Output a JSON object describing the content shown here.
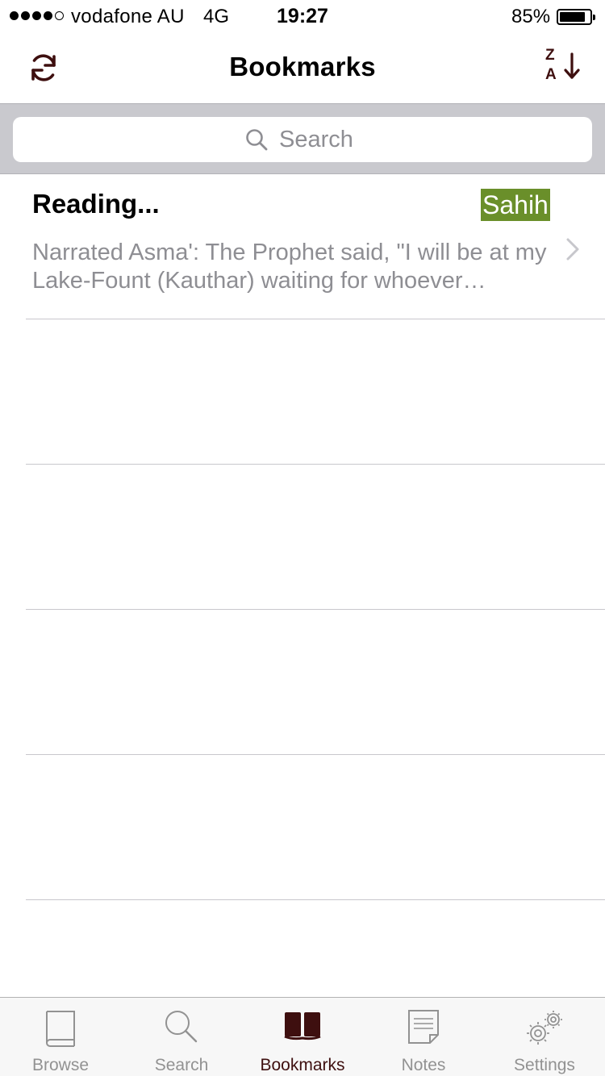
{
  "status_bar": {
    "carrier": "vodafone AU",
    "network": "4G",
    "time": "19:27",
    "battery": "85%",
    "battery_level": 0.85,
    "signal_bars_filled": 4,
    "signal_bars_total": 5
  },
  "nav": {
    "title": "Bookmarks",
    "refresh_icon": "refresh-icon",
    "sort_icon": "sort-z-a-icon",
    "sort_top": "Z",
    "sort_bottom": "A"
  },
  "search": {
    "placeholder": "Search",
    "icon": "search-icon"
  },
  "bookmarks": [
    {
      "title": "Reading...",
      "grade": "Sahih",
      "text": "Narrated Asma':  The Prophet said, \"I will be at my Lake-Fount (Kauthar) waiting for whoever…"
    }
  ],
  "tabs": [
    {
      "label": "Browse",
      "icon": "book-icon",
      "active": false
    },
    {
      "label": "Search",
      "icon": "search-icon",
      "active": false
    },
    {
      "label": "Bookmarks",
      "icon": "open-book-icon",
      "active": true
    },
    {
      "label": "Notes",
      "icon": "note-icon",
      "active": false
    },
    {
      "label": "Settings",
      "icon": "gears-icon",
      "active": false
    }
  ],
  "colors": {
    "accent": "#3e0f0f",
    "grade_badge": "#6a8f2a",
    "search_bg": "#c9c9ce",
    "secondary_text": "#8e8e93"
  }
}
